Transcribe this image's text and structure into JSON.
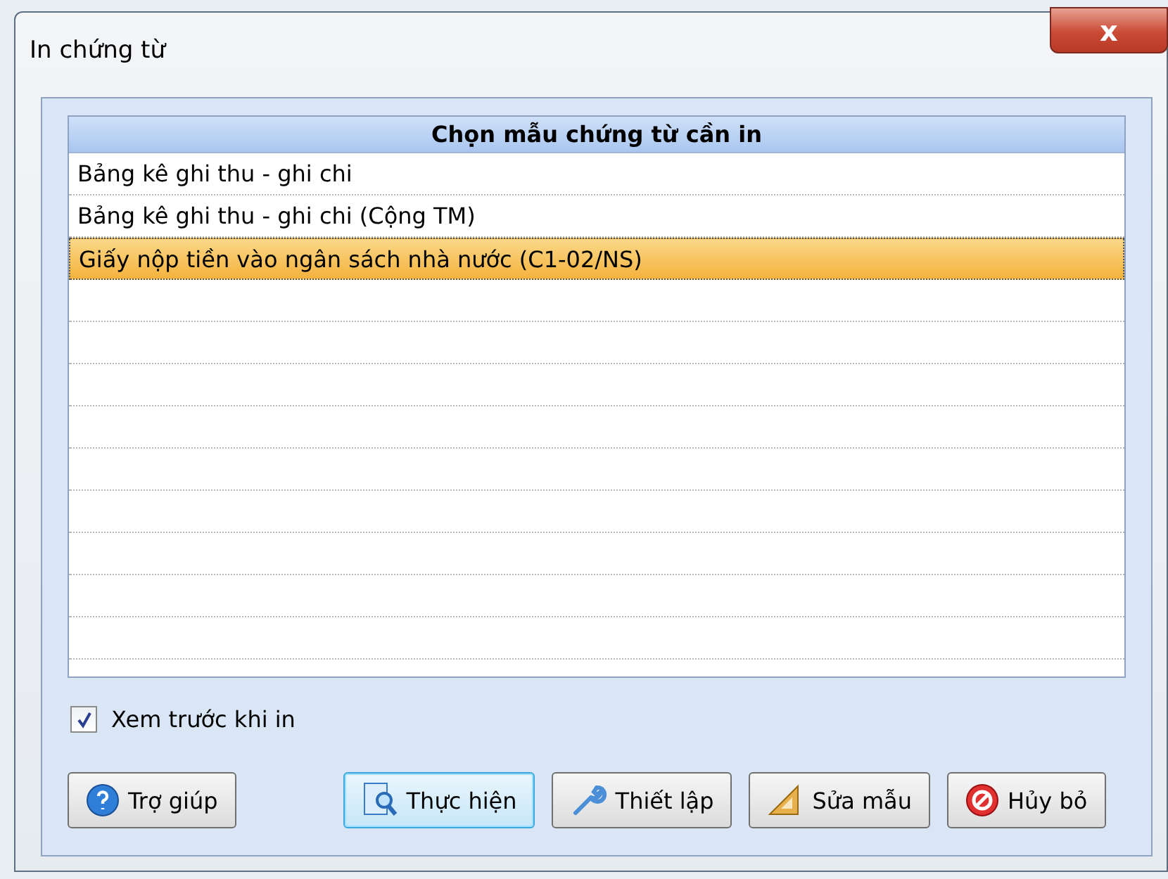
{
  "window": {
    "title": "In chứng từ",
    "close": "x"
  },
  "table": {
    "header": "Chọn mẫu chứng từ cần in",
    "rows": [
      {
        "label": "Bảng kê ghi thu - ghi chi",
        "selected": false
      },
      {
        "label": "Bảng kê ghi thu - ghi chi (Cộng TM)",
        "selected": false
      },
      {
        "label": "Giấy nộp tiền vào ngân sách nhà nước (C1-02/NS)",
        "selected": true
      }
    ]
  },
  "preview_checkbox": {
    "label": "Xem trước khi in",
    "checked": true
  },
  "buttons": [
    {
      "label": "Trợ giúp",
      "kind": "help",
      "default": false
    },
    {
      "label": "Thực hiện",
      "kind": "run",
      "default": true
    },
    {
      "label": "Thiết lập",
      "kind": "setup",
      "default": false
    },
    {
      "label": "Sửa mẫu",
      "kind": "edit",
      "default": false
    },
    {
      "label": "Hủy bỏ",
      "kind": "cancel",
      "default": false
    }
  ]
}
